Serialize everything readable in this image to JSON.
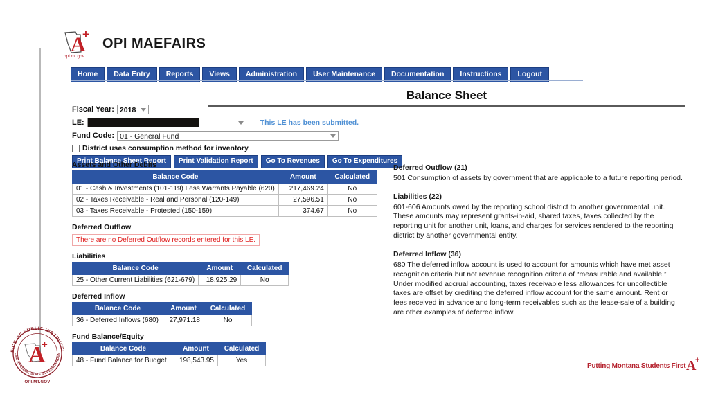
{
  "app": {
    "brand_title": "OPI  MAEFAIRS",
    "logo_caption": "opi.mt.gov",
    "logo_letter": "A",
    "logo_plus": "+"
  },
  "nav": {
    "items": [
      {
        "label": "Home",
        "name": "nav-item-home"
      },
      {
        "label": "Data Entry",
        "name": "nav-item-data-entry"
      },
      {
        "label": "Reports",
        "name": "nav-item-reports"
      },
      {
        "label": "Views",
        "name": "nav-item-views"
      },
      {
        "label": "Administration",
        "name": "nav-item-administration"
      },
      {
        "label": "User Maintenance",
        "name": "nav-item-user-maintenance"
      },
      {
        "label": "Documentation",
        "name": "nav-item-documentation"
      },
      {
        "label": "Instructions",
        "name": "nav-item-instructions"
      },
      {
        "label": "Logout",
        "name": "nav-item-logout"
      }
    ]
  },
  "page": {
    "title": "Balance Sheet"
  },
  "form": {
    "fiscal_year_label": "Fiscal Year:",
    "fiscal_year_value": "2018",
    "le_label": "LE:",
    "le_value": "",
    "le_status_note": "This LE has been submitted.",
    "fund_code_label": "Fund Code:",
    "fund_code_value": "01 - General Fund",
    "inventory_checkbox_label": "District uses consumption method for inventory",
    "inventory_checked": false,
    "buttons": [
      {
        "label": "Print Balance Sheet Report",
        "name": "print-balance-sheet-report-button"
      },
      {
        "label": "Print Validation Report",
        "name": "print-validation-report-button"
      },
      {
        "label": "Go To Revenues",
        "name": "go-to-revenues-button"
      },
      {
        "label": "Go To Expenditures",
        "name": "go-to-expenditures-button"
      }
    ]
  },
  "tables": {
    "columns": [
      "Balance Code",
      "Amount",
      "Calculated"
    ],
    "assets": {
      "heading": "Assets and Other Debits",
      "rows": [
        {
          "code": "01 - Cash & Investments (101-119) Less Warrants Payable (620)",
          "amount": "217,469.24",
          "calculated": "No"
        },
        {
          "code": "02 - Taxes Receivable - Real and Personal (120-149)",
          "amount": "27,596.51",
          "calculated": "No"
        },
        {
          "code": "03 - Taxes Receivable - Protested (150-159)",
          "amount": "374.67",
          "calculated": "No"
        }
      ]
    },
    "deferred_outflow": {
      "heading": "Deferred Outflow",
      "empty_message": "There are no Deferred Outflow records entered for this LE."
    },
    "liabilities": {
      "heading": "Liabilities",
      "rows": [
        {
          "code": "25 - Other Current Liabilities (621-679)",
          "amount": "18,925.29",
          "calculated": "No"
        }
      ]
    },
    "deferred_inflow": {
      "heading": "Deferred Inflow",
      "rows": [
        {
          "code": "36 - Deferred Inflows (680)",
          "amount": "27,971.18",
          "calculated": "No"
        }
      ]
    },
    "fund_balance": {
      "heading": "Fund Balance/Equity",
      "rows": [
        {
          "code": "48 - Fund Balance for Budget",
          "amount": "198,543.95",
          "calculated": "Yes"
        }
      ]
    }
  },
  "descriptions": [
    {
      "title": "Deferred Outflow (21)",
      "body": "501  Consumption of assets by government that are applicable to a future reporting period."
    },
    {
      "title": "Liabilities (22)",
      "body": "601-606  Amounts owed by the reporting school district to another governmental unit.  These amounts may represent grants-in-aid, shared taxes, taxes collected by the reporting unit for another unit, loans, and charges for services rendered to the reporting district by another governmental entity."
    },
    {
      "title": "Deferred Inflow (36)",
      "body": "680  The deferred inflow account is used to account for amounts which have met asset recognition criteria but not revenue recognition criteria of “measurable and available.” Under modified accrual accounting, taxes receivable less allowances for uncollectible taxes are offset by crediting the deferred inflow account for the same amount.  Rent or fees received in advance and long-term receivables such as the lease-sale of a building are other examples of deferred inflow."
    }
  ],
  "seal": {
    "ring_text_top": "OFFICE OF PUBLIC INSTRUCTION",
    "ring_text_bottom": "ELSIE ARNTZEN, STATE SUPERINTENDENT",
    "caption": "OPI.MT.GOV",
    "letter": "A",
    "plus": "+"
  },
  "footer": {
    "tagline": "Putting Montana Students First",
    "logo_letter": "A",
    "logo_plus": "+"
  },
  "colors": {
    "brand_blue": "#2c55a3",
    "link_blue": "#4f90d4",
    "warning_red": "#e02020",
    "seal_red": "#b5202c"
  }
}
